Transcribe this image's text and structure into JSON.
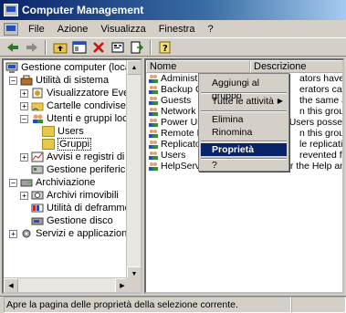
{
  "window": {
    "title": "Computer Management"
  },
  "menu": [
    "File",
    "Azione",
    "Visualizza",
    "Finestra",
    "?"
  ],
  "toolbar": [
    "back-icon",
    "forward-icon",
    "up-folder-icon",
    "properties-view-icon",
    "delete-icon",
    "properties-icon",
    "export-icon",
    "help-icon"
  ],
  "tree": {
    "root": "Gestione computer (locale)",
    "system_tools": "Utilità di sistema",
    "event_viewer": "Visualizzatore Eventi",
    "shared_folders": "Cartelle condivise",
    "users_groups": "Utenti e gruppi locali",
    "users": "Users",
    "groups": "Gruppi",
    "perf_logs": "Avvisi e registri di prestazion",
    "device_manager": "Gestione periferiche",
    "storage": "Archiviazione",
    "removable": "Archivi rimovibili",
    "defrag": "Utilità di deframmentazione c",
    "disk_mgmt": "Gestione disco",
    "services": "Servizi e applicazioni"
  },
  "list": {
    "columns": [
      "Nome",
      "Descrizione"
    ],
    "rows": [
      {
        "name": "Administrators",
        "desc": "ators have complet"
      },
      {
        "name": "Backup Operators",
        "desc": "erators can overr"
      },
      {
        "name": "Guests",
        "desc": "the same access"
      },
      {
        "name": "Network Configuration Operators",
        "desc": "n this group can ha"
      },
      {
        "name": "Power Users",
        "desc": "Users possess most a"
      },
      {
        "name": "Remote Desktop Users",
        "desc": "n this group are gra"
      },
      {
        "name": "Replicator",
        "desc": "le replication in a"
      },
      {
        "name": "Users",
        "desc": "revented from ma"
      },
      {
        "name": "HelpServicesGroup",
        "desc": "Group for the Help and Supp"
      }
    ]
  },
  "context_menu": {
    "add_to_group": "Aggiungi al gruppo",
    "all_tasks": "Tutte le attività",
    "delete": "Elimina",
    "rename": "Rinomina",
    "properties": "Proprietà",
    "help": "?"
  },
  "status": "Apre la pagina delle proprietà della selezione corrente."
}
